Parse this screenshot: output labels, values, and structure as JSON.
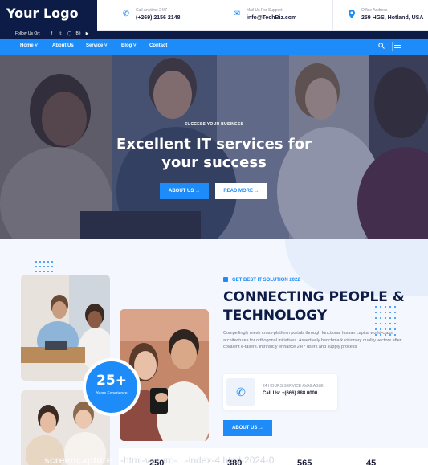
{
  "header": {
    "logo": "Your Logo",
    "contacts": [
      {
        "icon": "phone-icon",
        "label": "Call Anytime 24/7",
        "value": "(+269) 2156 2148"
      },
      {
        "icon": "mail-icon",
        "label": "Mail Us For Support",
        "value": "info@TechBiz.com"
      },
      {
        "icon": "location-icon",
        "label": "Office Address",
        "value": "259 HGS, Hotland, USA"
      }
    ]
  },
  "social": {
    "label": "Follow Us On:",
    "icons": [
      "facebook-icon",
      "twitter-icon",
      "instagram-icon",
      "behance-icon",
      "youtube-icon"
    ]
  },
  "nav": {
    "items": [
      "Home",
      "About Us",
      "Service",
      "Blog",
      "Contact"
    ]
  },
  "hero": {
    "subtitle": "SUCCESS YOUR BUSINESS",
    "title_line1": "Excellent IT services for",
    "title_line2": "your success",
    "primary_button": "ABOUT US →",
    "secondary_button": "READ MORE →"
  },
  "about": {
    "experience_number": "25+",
    "experience_label": "Years Experience",
    "tag": "GET BEST IT SOLUTION 2022",
    "heading_line1": "CONNECTING PEOPLE &",
    "heading_line2": "TECHNOLOGY",
    "paragraph": "Compellingly mesh cross-platform portals through functional human capital world-class architectures for orthogonal initiatives. Assertively benchmark visionary quality vectors after covalent e-tailers. Intrinsicly enhance 24/7 users and supply process",
    "service_label": "24 HOURS SERVICE AVAILABLE",
    "service_value": "Call Us: +(666) 888 0000",
    "button": "ABOUT US →"
  },
  "watermark": {
    "text": "screencapture",
    "tail": "-html-vecuro-...-index-4.html-2024-0"
  },
  "stats": [
    "250",
    "380",
    "565",
    "45"
  ],
  "colors": {
    "accent": "#1d8cf8",
    "navy": "#0d1c47"
  }
}
